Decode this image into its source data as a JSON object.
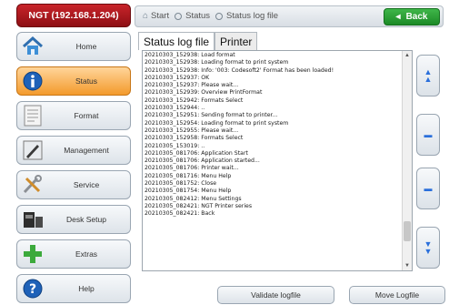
{
  "sidebar": {
    "device_title": "NGT (192.168.1.204)",
    "items": [
      {
        "label": "Home",
        "icon": "home-icon"
      },
      {
        "label": "Status",
        "icon": "info-icon"
      },
      {
        "label": "Format",
        "icon": "document-icon"
      },
      {
        "label": "Management",
        "icon": "pen-icon"
      },
      {
        "label": "Service",
        "icon": "tools-icon"
      },
      {
        "label": "Desk Setup",
        "icon": "desk-icon"
      },
      {
        "label": "Extras",
        "icon": "plus-icon"
      },
      {
        "label": "Help",
        "icon": "help-icon"
      }
    ],
    "active_index": 1
  },
  "header": {
    "breadcrumb": [
      "Start",
      "Status",
      "Status log file"
    ],
    "back_label": "Back"
  },
  "tabs": [
    {
      "label": "Status log file",
      "selected": true
    },
    {
      "label": "Printer",
      "selected": false
    }
  ],
  "log": {
    "lines": [
      "20210303_152938: Load format",
      "20210303_152938: Loading format to print system",
      "20210303_152938: Info: '003: Codesoft2' Format has been loaded!",
      "20210303_152937: OK",
      "20210303_152937: Please wait...",
      "20210303_152939: Overview PrintFormat",
      "20210303_152942: Formats Select",
      "20210303_152944: ..",
      "20210303_152951: Sending format to printer...",
      "20210303_152954: Loading format to print system",
      "20210303_152955: Please wait...",
      "20210303_152958: Formats Select",
      "20210305_153019: ..",
      "20210305_081706: Application Start",
      "20210305_081706: Application started...",
      "20210305_081706: Printer wait...",
      "20210305_081716: Menu Help",
      "20210305_081752: Close",
      "20210305_081754: Menu Help",
      "20210305_082412: Menu Settings",
      "20210305_082421: NGT Printer series",
      "20210305_082421: Back"
    ],
    "scroll_position": 0.88
  },
  "footer": {
    "validate_label": "Validate logfile",
    "move_label": "Move Logfile"
  },
  "colors": {
    "device_title_bg": "#b31b21",
    "active_nav": "#f5a640",
    "back_button": "#2aa336",
    "accent_blue": "#2a6fdb"
  }
}
